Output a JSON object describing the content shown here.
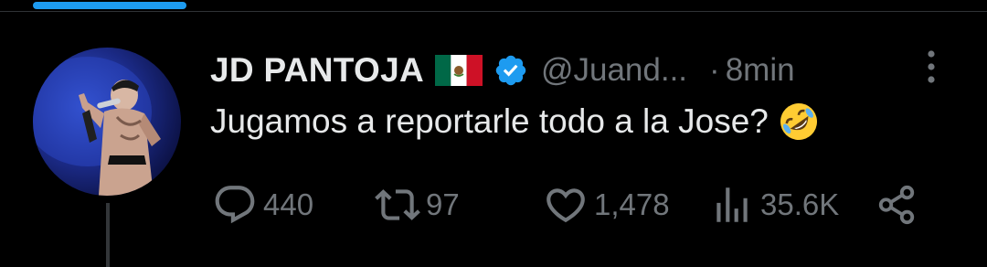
{
  "tweet": {
    "display_name": "JD PANTOJA",
    "handle": "@Juand...",
    "separator": "·",
    "time": "8min",
    "text": "Jugamos a reportarle todo a la Jose?",
    "flag": "mexico-flag",
    "emoji": "rolling-on-the-floor-laughing-emoji",
    "verified": true
  },
  "stats": {
    "replies": "440",
    "retweets": "97",
    "likes": "1,478",
    "views": "35.6K"
  },
  "colors": {
    "background": "#000000",
    "text_primary": "#e7e9ea",
    "text_secondary": "#71767b",
    "accent": "#1d9bf0"
  }
}
